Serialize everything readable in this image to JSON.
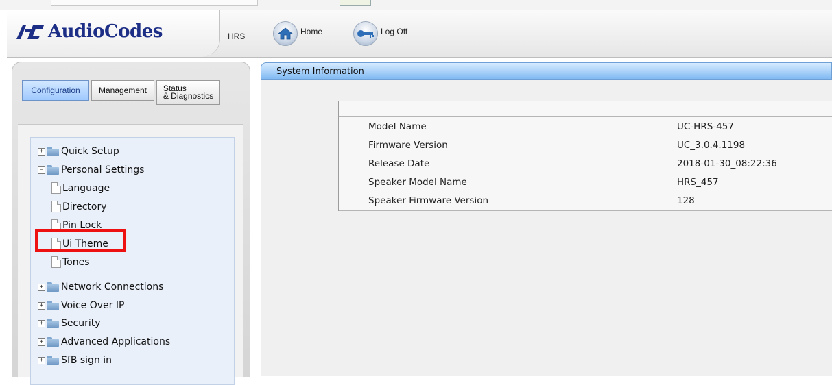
{
  "brand": {
    "logo_text": "AudioCodes",
    "device": "HRS"
  },
  "header": {
    "home_label": "Home",
    "logoff_label": "Log Off"
  },
  "tabs": {
    "configuration": "Configuration",
    "management": "Management",
    "status_line1": "Status",
    "status_line2": "& Diagnostics"
  },
  "tree": {
    "quick_setup": "Quick Setup",
    "personal_settings": "Personal Settings",
    "language": "Language",
    "directory": "Directory",
    "pin_lock": "Pin Lock",
    "ui_theme": "Ui Theme",
    "tones": "Tones",
    "network_connections": "Network Connections",
    "voice_over_ip": "Voice Over IP",
    "security": "Security",
    "advanced_applications": "Advanced Applications",
    "sfb_sign_in": "SfB sign in"
  },
  "panel": {
    "title": "System Information"
  },
  "system_info": [
    {
      "label": "Model Name",
      "value": "UC-HRS-457"
    },
    {
      "label": "Firmware Version",
      "value": "UC_3.0.4.1198"
    },
    {
      "label": "Release Date",
      "value": "2018-01-30_08:22:36"
    },
    {
      "label": "Speaker Model Name",
      "value": "HRS_457"
    },
    {
      "label": "Speaker Firmware Version",
      "value": "128"
    }
  ],
  "colors": {
    "accent_bar": "#7eb8f2",
    "highlight": "#ee1111",
    "brand": "#1c2e86"
  },
  "icons": {
    "home": "home-icon",
    "logoff": "key-icon",
    "folder": "folder-icon",
    "page": "page-icon"
  }
}
